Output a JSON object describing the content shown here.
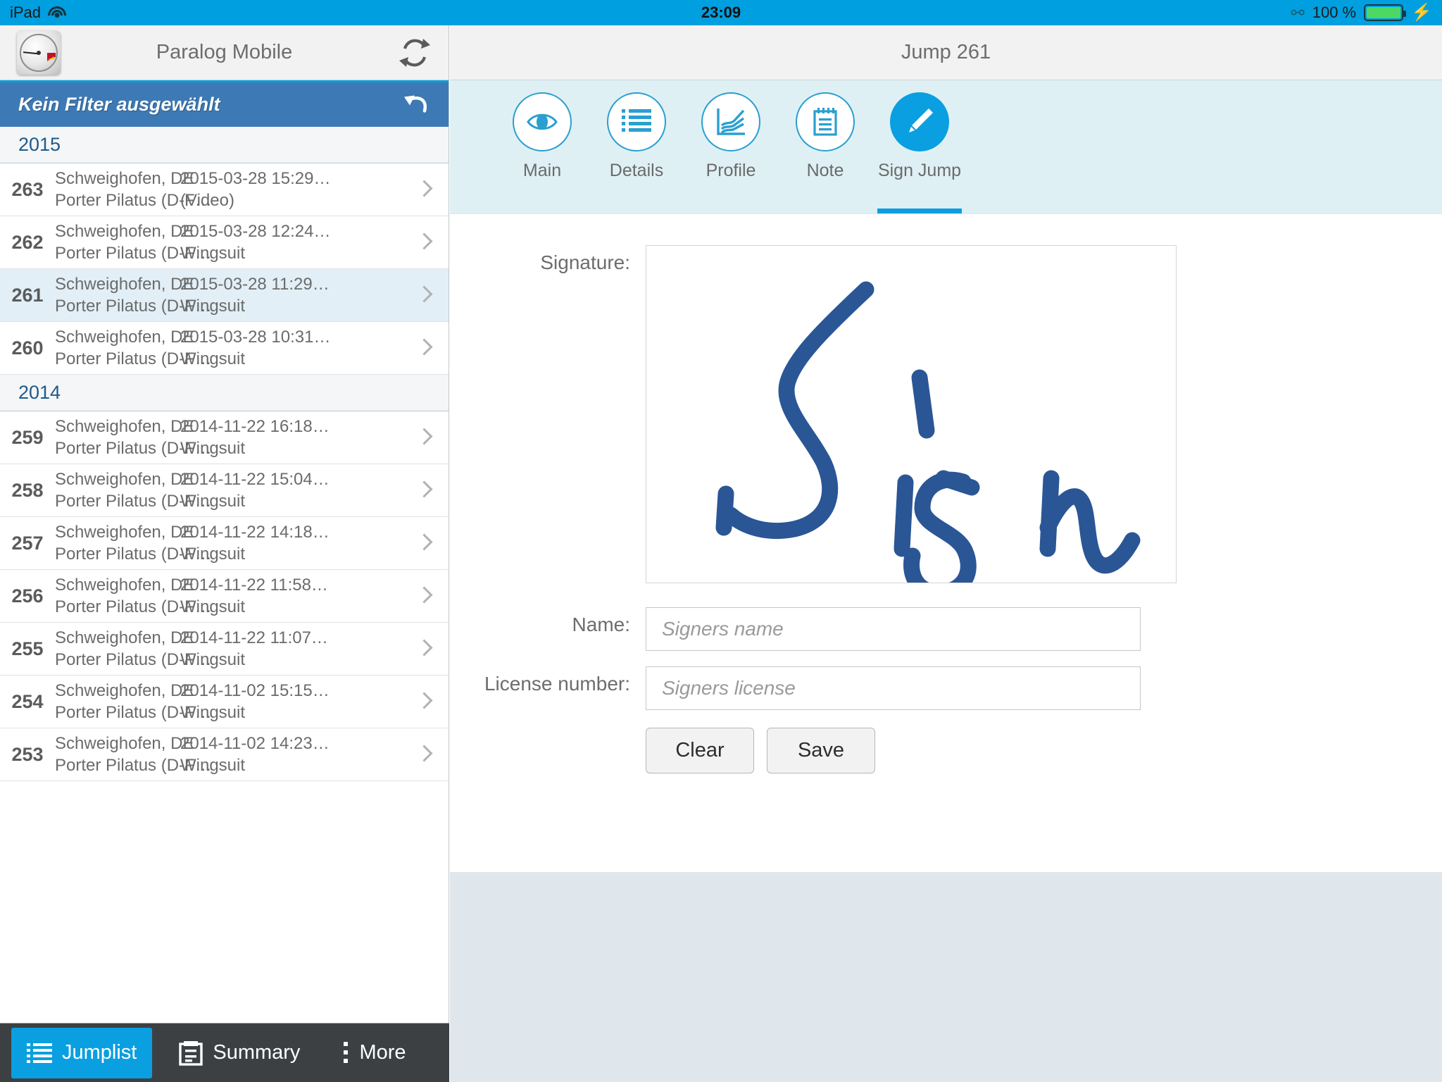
{
  "status_bar": {
    "device": "iPad",
    "wifi_icon": "wifi-icon",
    "time": "23:09",
    "bluetooth_icon": "bluetooth-icon",
    "battery_percent": "100 %",
    "battery_icon": "battery-full-icon",
    "charging_icon": "lightning-bolt-icon",
    "background_color": "#009fe0"
  },
  "left_panel": {
    "navbar": {
      "logo_icon": "altimeter-logo-icon",
      "title": "Paralog Mobile",
      "sync_icon": "refresh-sync-icon"
    },
    "filter_bar": {
      "text": "Kein Filter ausgewählt",
      "reset_icon": "undo-arrow-icon",
      "background_color": "#3d7ab5"
    },
    "list": [
      {
        "type": "year",
        "label": "2015"
      },
      {
        "type": "jump",
        "number": "263",
        "location": "Schweighofen, DE",
        "aircraft": "Porter Pilatus (D-F…",
        "datetime": "2015-03-28 15:29…",
        "kind": "(Video)",
        "selected": false
      },
      {
        "type": "jump",
        "number": "262",
        "location": "Schweighofen, DE",
        "aircraft": "Porter Pilatus (D-F…",
        "datetime": "2015-03-28 12:24…",
        "kind": "Wingsuit",
        "selected": false
      },
      {
        "type": "jump",
        "number": "261",
        "location": "Schweighofen, DE",
        "aircraft": "Porter Pilatus (D-F…",
        "datetime": "2015-03-28 11:29…",
        "kind": "Wingsuit",
        "selected": true
      },
      {
        "type": "jump",
        "number": "260",
        "location": "Schweighofen, DE",
        "aircraft": "Porter Pilatus (D-F…",
        "datetime": "2015-03-28 10:31…",
        "kind": "Wingsuit",
        "selected": false
      },
      {
        "type": "year",
        "label": "2014"
      },
      {
        "type": "jump",
        "number": "259",
        "location": "Schweighofen, DE",
        "aircraft": "Porter Pilatus (D-F…",
        "datetime": "2014-11-22 16:18…",
        "kind": "Wingsuit",
        "selected": false
      },
      {
        "type": "jump",
        "number": "258",
        "location": "Schweighofen, DE",
        "aircraft": "Porter Pilatus (D-F…",
        "datetime": "2014-11-22 15:04…",
        "kind": "Wingsuit",
        "selected": false
      },
      {
        "type": "jump",
        "number": "257",
        "location": "Schweighofen, DE",
        "aircraft": "Porter Pilatus (D-F…",
        "datetime": "2014-11-22 14:18…",
        "kind": "Wingsuit",
        "selected": false
      },
      {
        "type": "jump",
        "number": "256",
        "location": "Schweighofen, DE",
        "aircraft": "Porter Pilatus (D-F…",
        "datetime": "2014-11-22 11:58…",
        "kind": "Wingsuit",
        "selected": false
      },
      {
        "type": "jump",
        "number": "255",
        "location": "Schweighofen, DE",
        "aircraft": "Porter Pilatus (D-F…",
        "datetime": "2014-11-22 11:07…",
        "kind": "Wingsuit",
        "selected": false
      },
      {
        "type": "jump",
        "number": "254",
        "location": "Schweighofen, DE",
        "aircraft": "Porter Pilatus (D-F…",
        "datetime": "2014-11-02 15:15…",
        "kind": "Wingsuit",
        "selected": false
      },
      {
        "type": "jump",
        "number": "253",
        "location": "Schweighofen, DE",
        "aircraft": "Porter Pilatus (D-F…",
        "datetime": "2014-11-02 14:23…",
        "kind": "Wingsuit",
        "selected": false
      }
    ],
    "toolbar": {
      "items": [
        {
          "label": "Jumplist",
          "icon": "list-icon",
          "active": true
        },
        {
          "label": "Summary",
          "icon": "clipboard-icon",
          "active": false
        },
        {
          "label": "More",
          "icon": "vertical-dots-icon",
          "active": false
        }
      ],
      "active_color": "#0a9fe0",
      "background_color": "#3c4043"
    }
  },
  "right_panel": {
    "title": "Jump 261",
    "tabs": [
      {
        "label": "Main",
        "icon": "eye-icon",
        "active": false
      },
      {
        "label": "Details",
        "icon": "list-lines-icon",
        "active": false
      },
      {
        "label": "Profile",
        "icon": "line-chart-icon",
        "active": false
      },
      {
        "label": "Note",
        "icon": "notepad-icon",
        "active": false
      },
      {
        "label": "Sign Jump",
        "icon": "pencil-icon",
        "active": true
      }
    ],
    "form": {
      "signature_label": "Signature:",
      "signature_value": "Sign",
      "signature_ink_color": "#2a5696",
      "name_label": "Name:",
      "name_value": "",
      "name_placeholder": "Signers name",
      "license_label": "License number:",
      "license_value": "",
      "license_placeholder": "Signers license",
      "clear_button": "Clear",
      "save_button": "Save"
    }
  }
}
